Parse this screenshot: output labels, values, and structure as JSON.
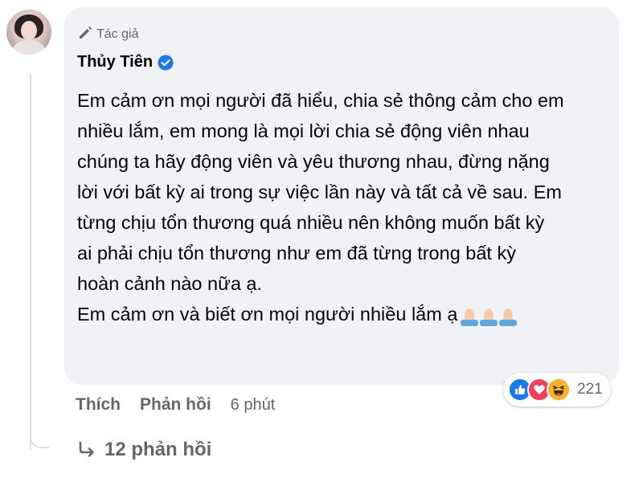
{
  "comment": {
    "author_badge": "Tác giả",
    "author_name": "Thủy Tiên",
    "lines": [
      "Em cảm ơn mọi người đã hiểu, chia sẻ thông cảm cho em",
      "nhiều lắm, em mong là mọi lời chia sẻ động viên nhau",
      "chúng ta hãy động viên và yêu thương nhau, đừng nặng",
      "lời với bất kỳ ai trong sự việc lần này và tất cả về sau. Em",
      "từng chịu tổn thương quá nhiều nên không muốn bất kỳ",
      "ai phải chịu tổn thương như em đã từng trong bất kỳ",
      "hoàn cảnh nào nữa ạ.",
      "Em cảm ơn và biết ơn mọi người nhiều lắm ạ"
    ],
    "trailing_emojis": [
      "folded-hands",
      "folded-hands",
      "folded-hands"
    ]
  },
  "reactions": {
    "icons": [
      "like",
      "love",
      "haha"
    ],
    "count": "221"
  },
  "actions": {
    "like": "Thích",
    "reply": "Phản hồi",
    "time": "6 phút"
  },
  "replies": {
    "label": "12 phản hồi"
  },
  "colors": {
    "bubble": "#f0f2f5",
    "secondary_text": "#65676b",
    "verified": "#1877f2",
    "like": "#1877f2",
    "love": "#f33e58",
    "haha": "#f7b125"
  }
}
